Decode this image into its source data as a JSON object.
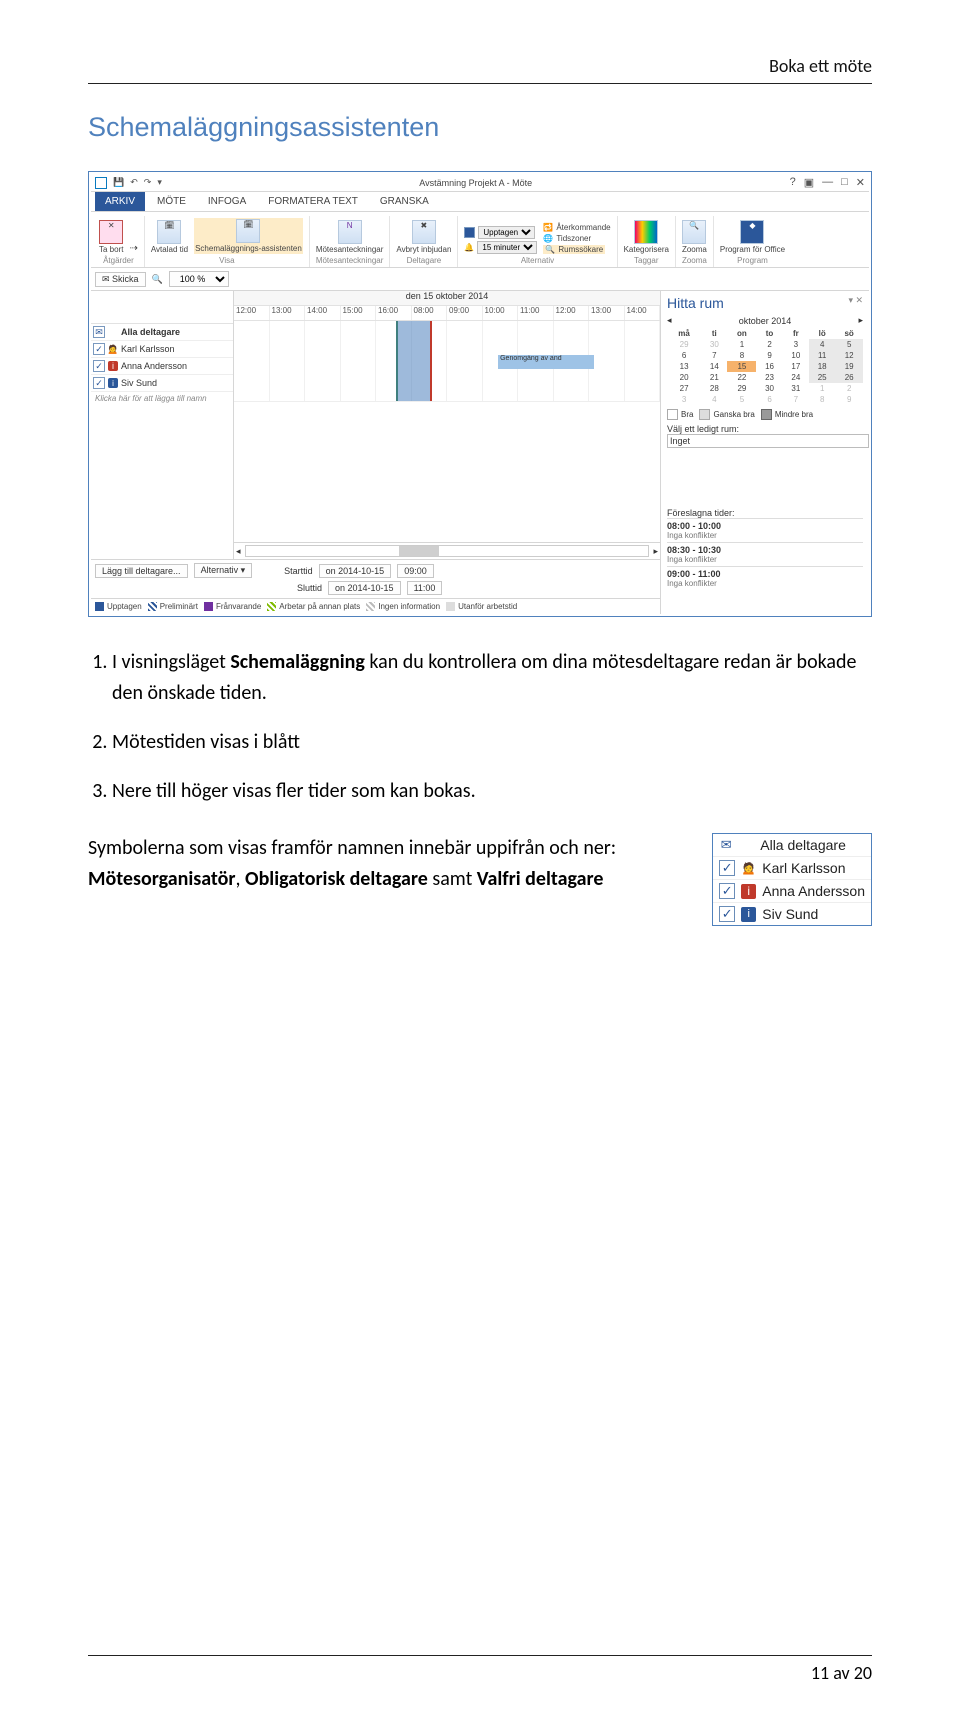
{
  "doc": {
    "header": "Boka ett möte",
    "section_title": "Schemaläggningsassistenten",
    "footer": "11 av 20"
  },
  "list": {
    "i1_a": "I visningsläget ",
    "i1_bold": "Schemaläggning",
    "i1_b": " kan du kontrollera om dina mötesdeltagare redan är bokade den önskade tiden.",
    "i2": "Mötestiden visas i blått",
    "i3": "Nere till höger visas fler tider som kan bokas."
  },
  "para": {
    "a": "Symbolerna som visas framför namnen innebär uppifrån och ner: ",
    "b1": "Mötesorganisatör",
    "sep1": ", ",
    "b2": "Obligatorisk deltagare",
    "mid": " samt ",
    "b3": "Valfri deltagare"
  },
  "shot": {
    "title": "Avstämning Projekt A - Möte",
    "tabs": [
      "ARKIV",
      "MÖTE",
      "INFOGA",
      "FORMATERA TEXT",
      "GRANSKA"
    ],
    "groups": {
      "atgarder": {
        "label": "Åtgärder",
        "items": [
          "Ta bort"
        ]
      },
      "visa": {
        "label": "Visa",
        "items": [
          "Avtalad tid",
          "Schemaläggnings-assistenten"
        ]
      },
      "anteck": {
        "label": "Mötesanteckningar",
        "items": [
          "Mötesanteckningar"
        ]
      },
      "deltagare": {
        "label": "Deltagare",
        "items": [
          "Avbryt inbjudan"
        ]
      },
      "alternativ": {
        "label": "Alternativ",
        "upptagen": "Upptagen",
        "dur": "15 minuter",
        "aterk": "Återkommande",
        "tz": "Tidszoner",
        "rum": "Rumssökare"
      },
      "taggar": {
        "label": "Taggar",
        "items": [
          "Kategorisera"
        ]
      },
      "zoom": {
        "label": "Zooma",
        "items": [
          "Zooma"
        ]
      },
      "program": {
        "label": "Program",
        "items": [
          "Program för Office"
        ]
      }
    },
    "band2": {
      "skicka": "Skicka",
      "zoom": "100 %"
    },
    "date_header": "den 15 oktober 2014",
    "hours": [
      "12:00",
      "13:00",
      "14:00",
      "15:00",
      "16:00",
      "08:00",
      "09:00",
      "10:00",
      "11:00",
      "12:00",
      "13:00",
      "14:00"
    ],
    "attendees": [
      {
        "checked": true,
        "sym": "mail",
        "name": "Alla deltagare",
        "bold": true
      },
      {
        "checked": true,
        "sym": "head",
        "name": "Karl Karlsson"
      },
      {
        "checked": true,
        "sym": "red",
        "name": "Anna Andersson"
      },
      {
        "checked": true,
        "sym": "blue",
        "name": "Siv Sund"
      }
    ],
    "add_hint": "Klicka här för att lägga till namn",
    "busy_label": "Genomgång av and",
    "footer": {
      "add": "Lägg till deltagare...",
      "alt": "Alternativ",
      "start_l": "Starttid",
      "start_d": "on 2014-10-15",
      "start_t": "09:00",
      "end_l": "Sluttid",
      "end_d": "on 2014-10-15",
      "end_t": "11:00"
    },
    "legend": {
      "upptagen": "Upptagen",
      "prel": "Preliminärt",
      "fran": "Frånvarande",
      "annan": "Arbetar på annan plats",
      "ingen": "Ingen information",
      "utanfor": "Utanför arbetstid"
    },
    "rooms": {
      "title": "Hitta rum",
      "month": "oktober 2014",
      "dow": [
        "må",
        "ti",
        "on",
        "to",
        "fr",
        "lö",
        "sö"
      ],
      "weeks": [
        [
          "29",
          "30",
          "1",
          "2",
          "3",
          "4",
          "5"
        ],
        [
          "6",
          "7",
          "8",
          "9",
          "10",
          "11",
          "12"
        ],
        [
          "13",
          "14",
          "15",
          "16",
          "17",
          "18",
          "19"
        ],
        [
          "20",
          "21",
          "22",
          "23",
          "24",
          "25",
          "26"
        ],
        [
          "27",
          "28",
          "29",
          "30",
          "31",
          "1",
          "2"
        ],
        [
          "3",
          "4",
          "5",
          "6",
          "7",
          "8",
          "9"
        ]
      ],
      "rl": {
        "bra": "Bra",
        "ganska": "Ganska bra",
        "mindre": "Mindre bra"
      },
      "pick_label": "Välj ett ledigt rum:",
      "pick_value": "Inget",
      "sugg_title": "Föreslagna tider:",
      "suggestions": [
        {
          "t": "08:00 - 10:00",
          "s": "Inga konflikter"
        },
        {
          "t": "08:30 - 10:30",
          "s": "Inga konflikter"
        },
        {
          "t": "09:00 - 11:00",
          "s": "Inga konflikter"
        }
      ]
    }
  },
  "enlarge": {
    "rows": [
      {
        "chk": "mail",
        "sym": "mail",
        "name": "Alla deltagare"
      },
      {
        "chk": "check",
        "sym": "head",
        "name": "Karl Karlsson"
      },
      {
        "chk": "check",
        "sym": "red",
        "name": "Anna Andersson"
      },
      {
        "chk": "check",
        "sym": "blue",
        "name": "Siv Sund"
      }
    ]
  }
}
